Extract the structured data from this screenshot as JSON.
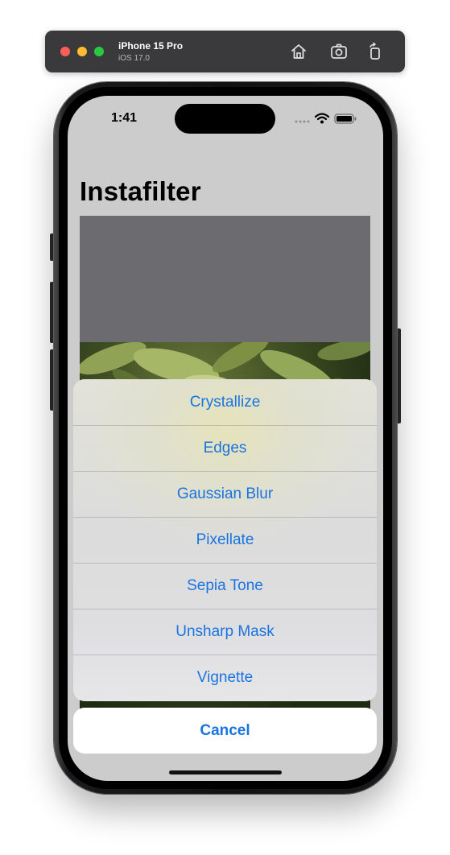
{
  "simulator": {
    "device_name": "iPhone 15 Pro",
    "os_version": "iOS 17.0",
    "buttons": [
      {
        "icon": "home-icon"
      },
      {
        "icon": "screenshot-icon"
      },
      {
        "icon": "rotate-icon"
      }
    ]
  },
  "status_bar": {
    "time": "1:41",
    "icons": [
      "cellular-icon",
      "wifi-icon",
      "battery-icon"
    ]
  },
  "app": {
    "title": "Instafilter"
  },
  "action_sheet": {
    "items": [
      {
        "label": "Crystallize"
      },
      {
        "label": "Edges"
      },
      {
        "label": "Gaussian Blur"
      },
      {
        "label": "Pixellate"
      },
      {
        "label": "Sepia Tone"
      },
      {
        "label": "Unsharp Mask"
      },
      {
        "label": "Vignette"
      }
    ],
    "cancel_label": "Cancel"
  },
  "colors": {
    "accent": "#1a74e0",
    "screen_background": "#cccccc",
    "placeholder_gray": "#6c6c70"
  }
}
